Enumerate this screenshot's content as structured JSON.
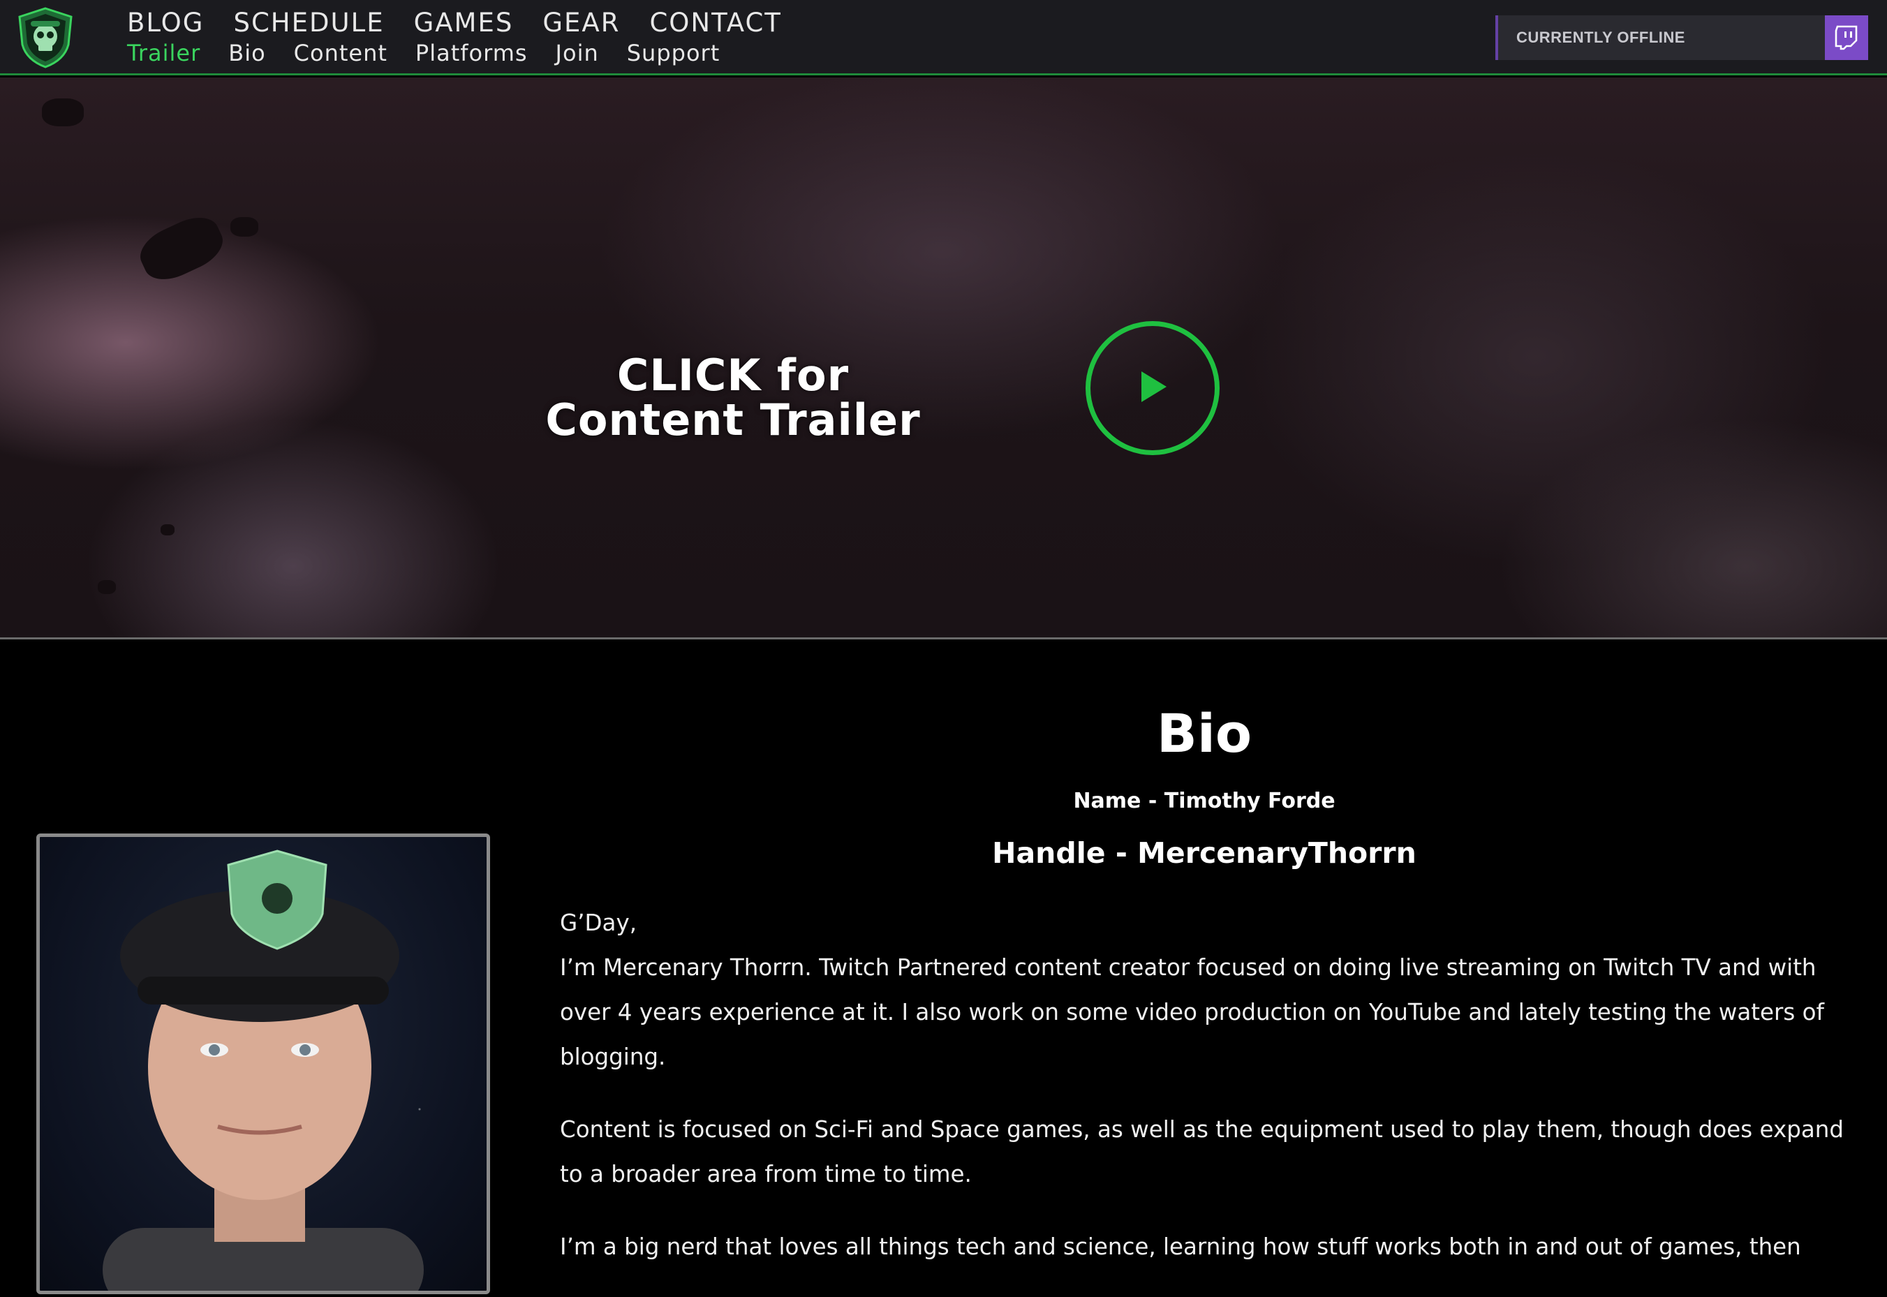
{
  "nav": {
    "primary": [
      "BLOG",
      "SCHEDULE",
      "GAMES",
      "GEAR",
      "CONTACT"
    ],
    "secondary": [
      "Trailer",
      "Bio",
      "Content",
      "Platforms",
      "Join",
      "Support"
    ],
    "active_secondary": "Trailer"
  },
  "twitch": {
    "status": "CURRENTLY OFFLINE",
    "icon": "twitch-icon"
  },
  "hero": {
    "line1": "CLICK for",
    "line2": "Content Trailer",
    "play_icon": "play-icon"
  },
  "bio": {
    "title": "Bio",
    "name": "Name - Timothy Forde",
    "handle": "Handle - MercenaryThorrn",
    "greeting": "G’Day,",
    "para1": "I’m Mercenary Thorrn. Twitch Partnered content creator focused on doing live streaming on Twitch TV and with over 4 years experience at it. I also work on some video production on YouTube and lately testing the waters of blogging.",
    "para2": "Content is focused on Sci-Fi and Space games, as well as the equipment used to play them, though does expand to a broader area from time to time.",
    "para3": "I’m a big nerd that loves all things tech and science, learning how stuff works both in and out of games, then"
  },
  "colors": {
    "accent_green": "#3ad45e",
    "twitch_purple": "#7b4bc7",
    "header_bg": "#1b1b1f"
  }
}
